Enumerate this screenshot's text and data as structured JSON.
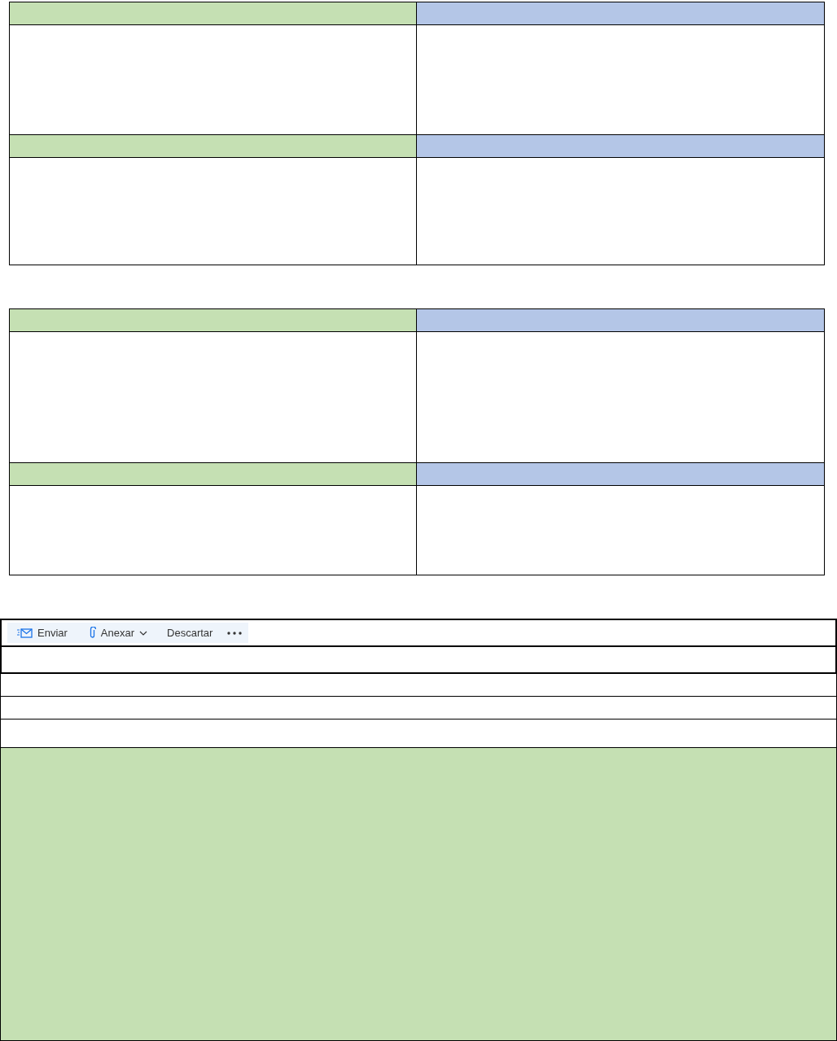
{
  "toolbar": [
    {
      "kind": "send",
      "label": "Enviar"
    },
    {
      "kind": "attach",
      "label": "Anexar"
    },
    {
      "kind": "plain",
      "label": "Descartar"
    },
    {
      "kind": "more"
    }
  ]
}
